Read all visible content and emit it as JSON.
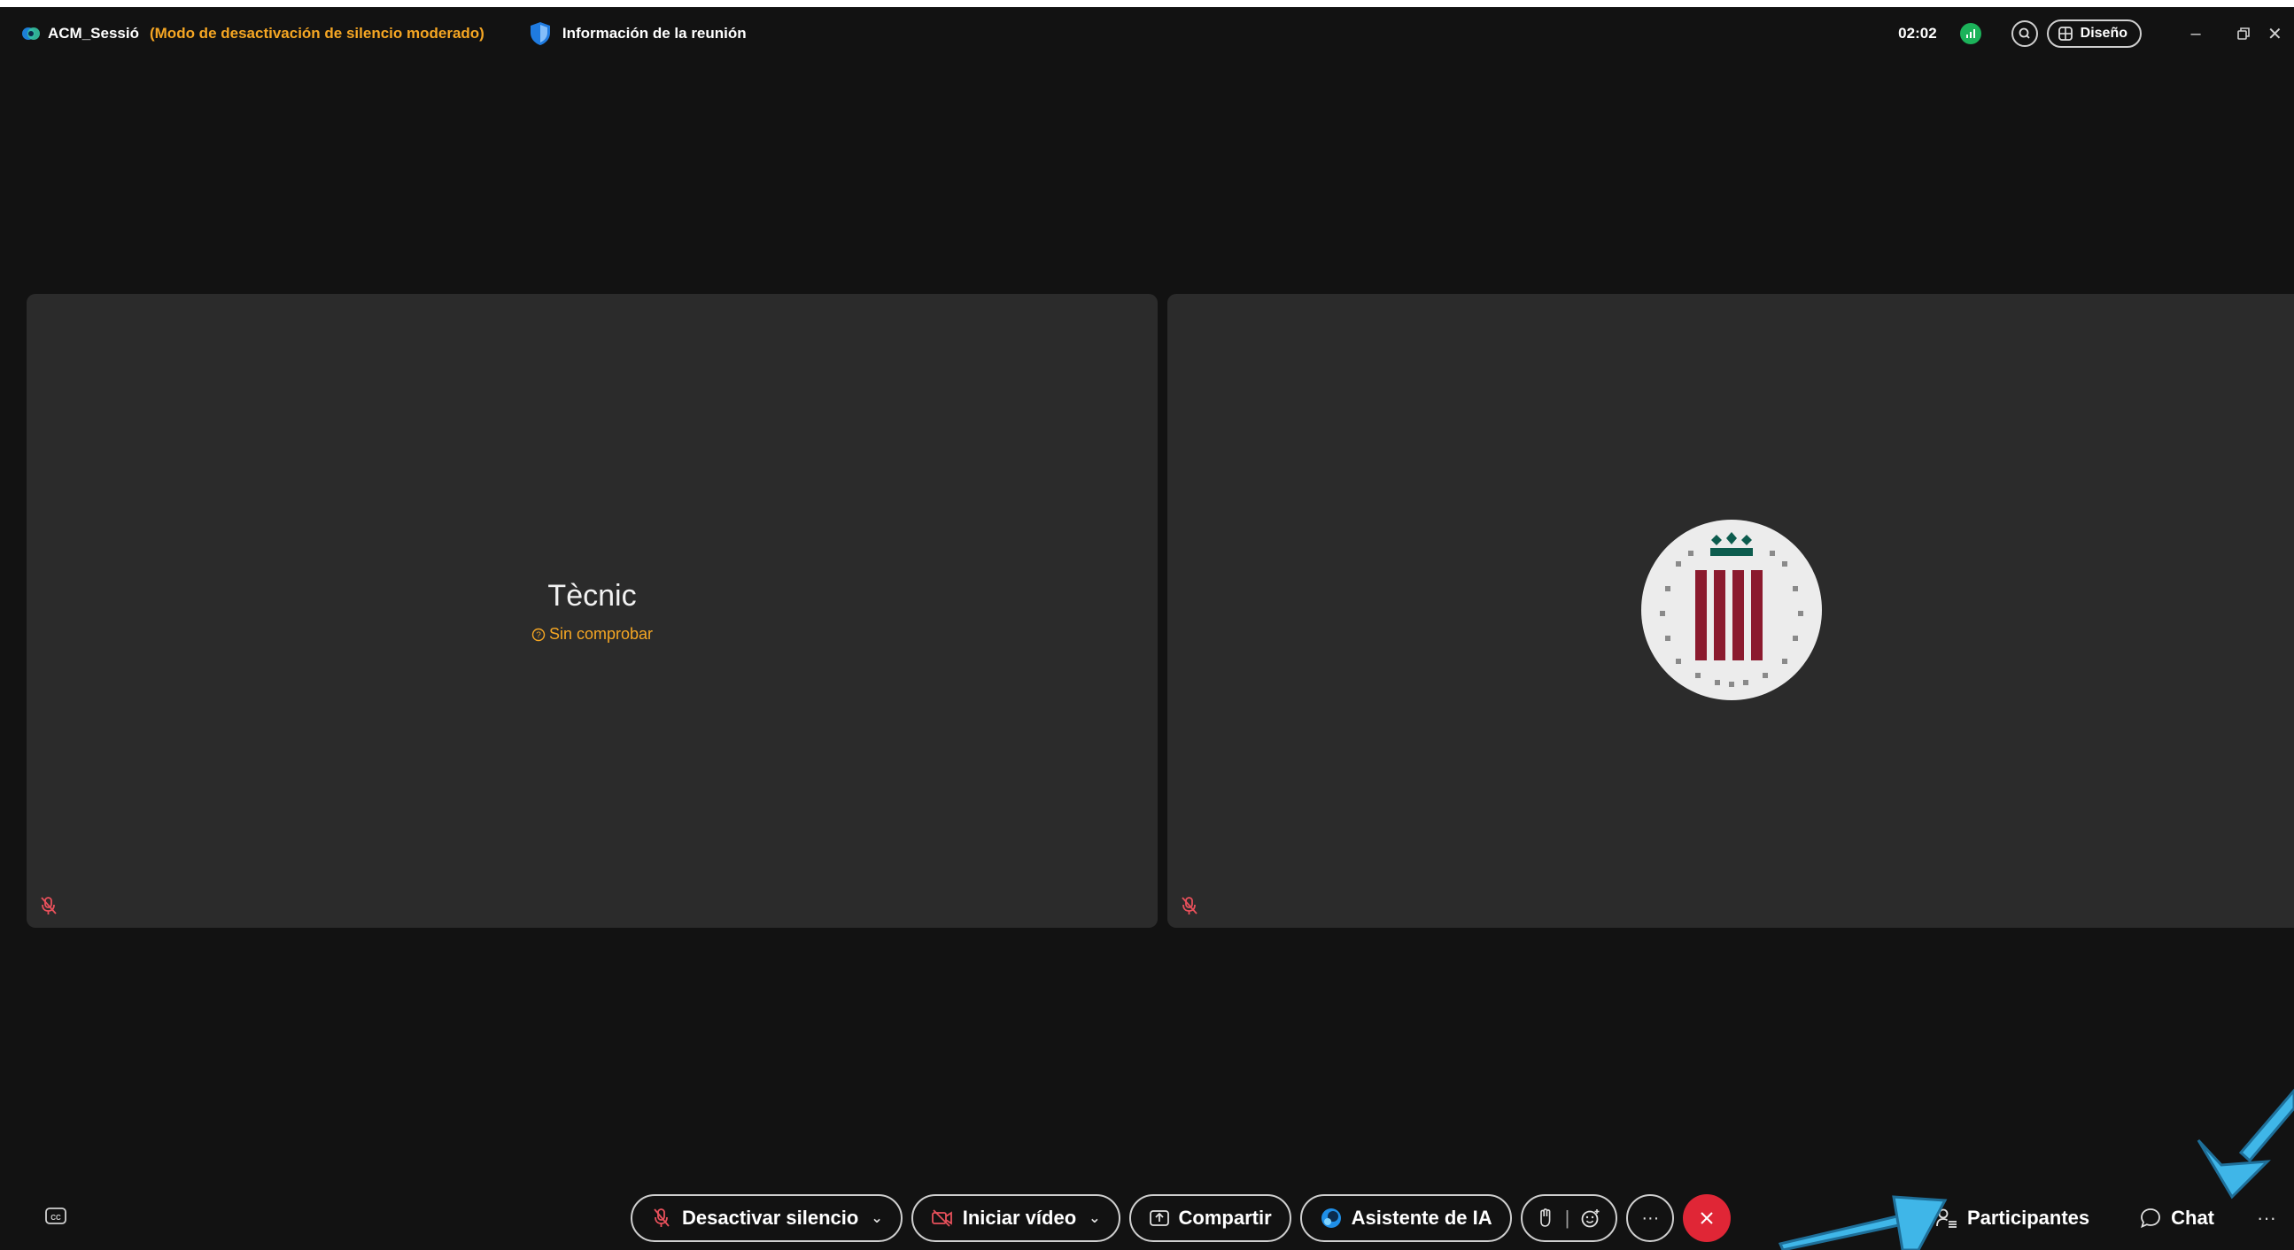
{
  "titlebar": {
    "meeting_name": "ACM_Sessió",
    "mode_label": "(Modo de desactivación de silencio moderado)",
    "meeting_info": "Información de la reunión",
    "elapsed_time": "02:02",
    "layout_label": "Diseño",
    "icons": [
      "webex-logo-icon",
      "shield-icon",
      "signal-icon",
      "search-icon",
      "grid-layout-icon",
      "minimize-icon",
      "restore-icon",
      "close-icon"
    ]
  },
  "tiles": [
    {
      "name": "Tècnic",
      "status": "Sin comprobar",
      "muted": true
    },
    {
      "name": "",
      "muted": true,
      "avatar": "institution-logo"
    }
  ],
  "controls": {
    "unmute_label": "Desactivar silencio",
    "video_label": "Iniciar vídeo",
    "share_label": "Compartir",
    "ai_label": "Asistente de IA",
    "more_label": "···"
  },
  "panels": {
    "participants_label": "Participantes",
    "chat_label": "Chat",
    "more_label": "···"
  },
  "colors": {
    "accent_orange": "#f5a623",
    "leave_red": "#e02636",
    "signal_green": "#1cb35a",
    "annotation_arrow": "#3fb6e8",
    "avatar_maroon": "#8b1a2e",
    "avatar_green": "#0d5c4e"
  }
}
